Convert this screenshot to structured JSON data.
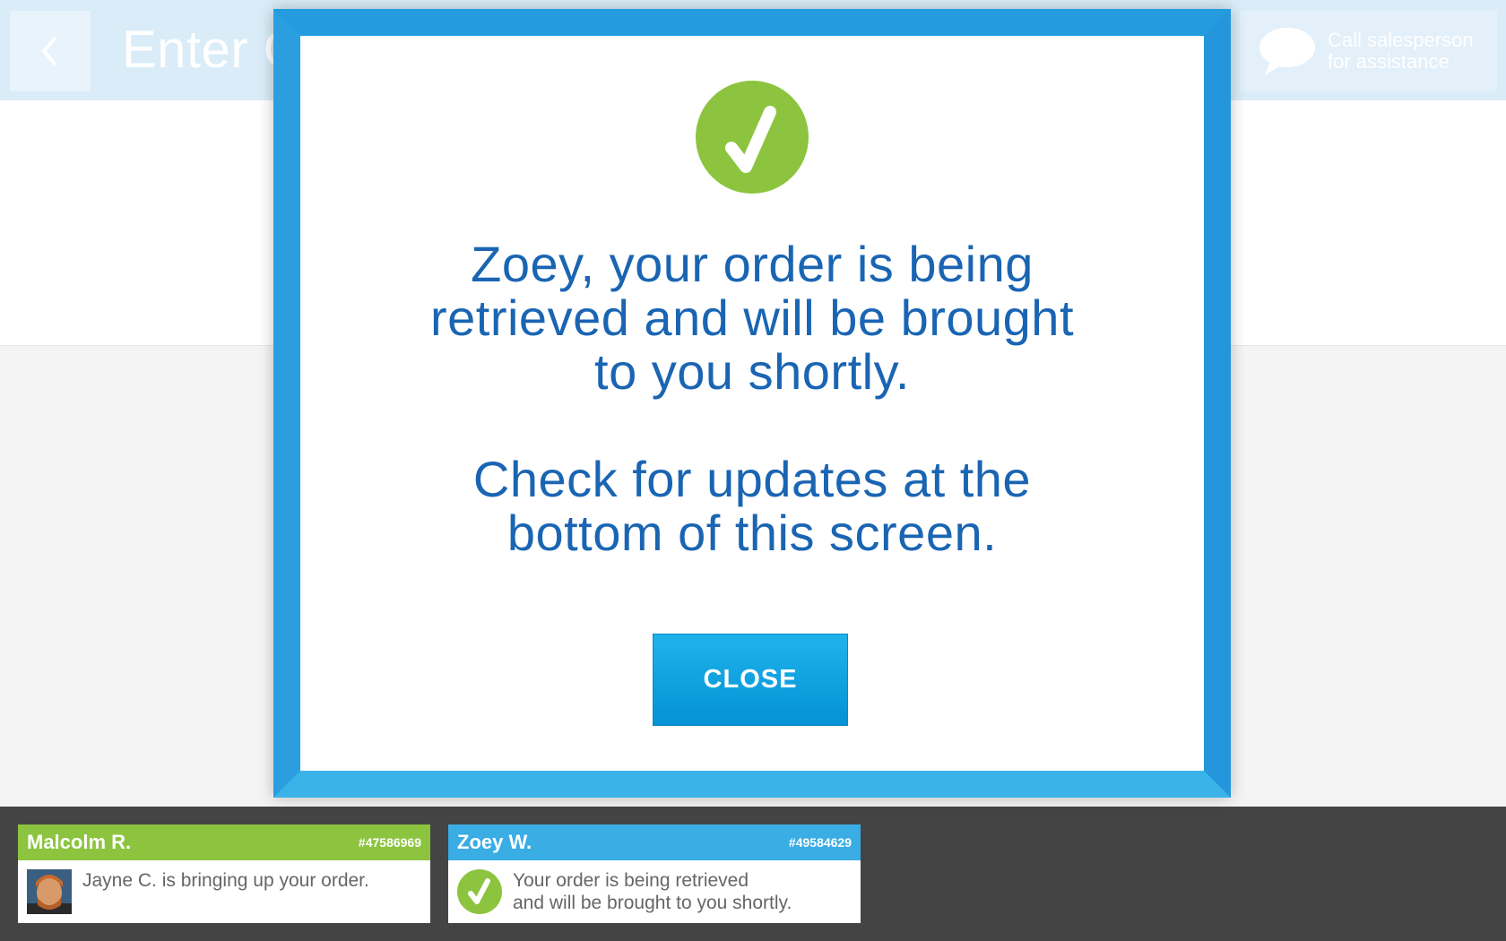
{
  "header": {
    "title": "Enter C",
    "assist_line1": "Call salesperson",
    "assist_line2": "for assistance"
  },
  "modal": {
    "message_line1": "Zoey, your order is being",
    "message_line2": "retrieved and will be brought",
    "message_line3": "to you shortly.",
    "updates_line1": "Check for updates at the",
    "updates_line2": "bottom of this screen.",
    "close_label": "CLOSE"
  },
  "notifications": [
    {
      "name": "Malcolm R.",
      "order": "#47586969",
      "message_line1": "Jayne C. is bringing up your order.",
      "message_line2": ""
    },
    {
      "name": "Zoey W.",
      "order": "#49584629",
      "message_line1": "Your order is being retrieved",
      "message_line2": "and will be brought to you shortly."
    }
  ],
  "colors": {
    "modal_border": "#2a9fe0",
    "modal_text": "#1a65b3",
    "success_green": "#8cc43f",
    "button_blue": "#1fb3ea",
    "status_bar": "#444444"
  },
  "icons": {
    "back": "chevron-left-icon",
    "chat": "chat-bubble-icon",
    "success": "checkmark-circle-icon",
    "avatar": "avatar"
  }
}
